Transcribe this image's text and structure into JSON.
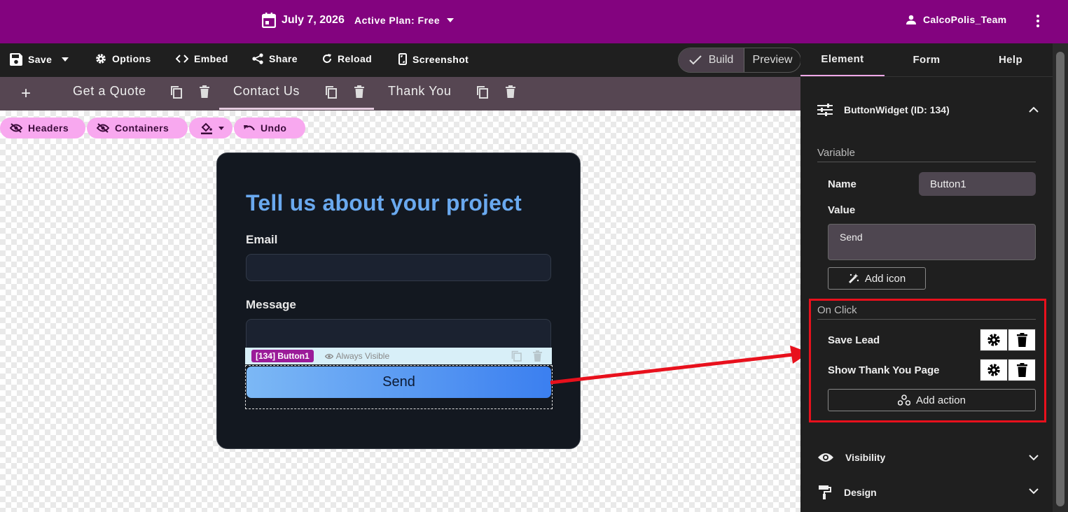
{
  "topbar": {
    "date": "July 7, 2026",
    "plan": "Active Plan: Free",
    "user": "CalcoPolis_Team",
    "bg_color": "#83037f"
  },
  "toolbar": {
    "save": "Save",
    "options": "Options",
    "embed": "Embed",
    "share": "Share",
    "reload": "Reload",
    "screenshot": "Screenshot",
    "build": "Build",
    "preview": "Preview"
  },
  "pages": {
    "tabs": [
      "Get a Quote",
      "Contact Us",
      "Thank You"
    ],
    "active": "Contact Us"
  },
  "chips": {
    "headers": "Headers",
    "containers": "Containers",
    "undo": "Undo"
  },
  "form": {
    "title": "Tell us about your project",
    "email_label": "Email",
    "message_label": "Message",
    "widget_tag": "[134] Button1",
    "visibility": "Always Visible",
    "button_label": "Send",
    "accent_color": "#6aa9ef"
  },
  "panel": {
    "tabs": [
      "Element",
      "Form",
      "Help"
    ],
    "widget_title": "ButtonWidget (ID: 134)",
    "variable_heading": "Variable",
    "name_label": "Name",
    "name_value": "Button1",
    "value_label": "Value",
    "value_text": "Send",
    "add_icon": "Add icon",
    "onclick_heading": "On Click",
    "actions": [
      "Save Lead",
      "Show Thank You Page"
    ],
    "add_action": "Add action",
    "visibility": "Visibility",
    "design": "Design",
    "highlight_color": "#e8101c"
  }
}
